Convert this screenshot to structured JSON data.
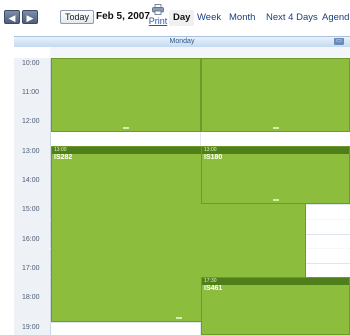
{
  "toolbar": {
    "prev_glyph": "◀",
    "next_glyph": "▶",
    "today_label": "Today",
    "current_date": "Feb 5, 2007",
    "print_label": "Print",
    "views": [
      "Day",
      "Week",
      "Month",
      "Next 4 Days",
      "Agend"
    ],
    "active_view": "Day"
  },
  "day_header": {
    "label": "Monday"
  },
  "hours": [
    "10:00",
    "11:00",
    "12:00",
    "13:00",
    "14:00",
    "15:00",
    "16:00",
    "17:00",
    "18:00",
    "19:00"
  ],
  "events": [
    {
      "time": "",
      "title": ""
    },
    {
      "time": "",
      "title": ""
    },
    {
      "time": "13:00",
      "title": "IS282"
    },
    {
      "time": "13:00",
      "title": "IS180"
    },
    {
      "time": "17:30",
      "title": "IS461"
    }
  ],
  "colors": {
    "event_fill": "#8cbd3c",
    "event_header": "#4f7f1a",
    "header_bar": "#c4daf2"
  }
}
